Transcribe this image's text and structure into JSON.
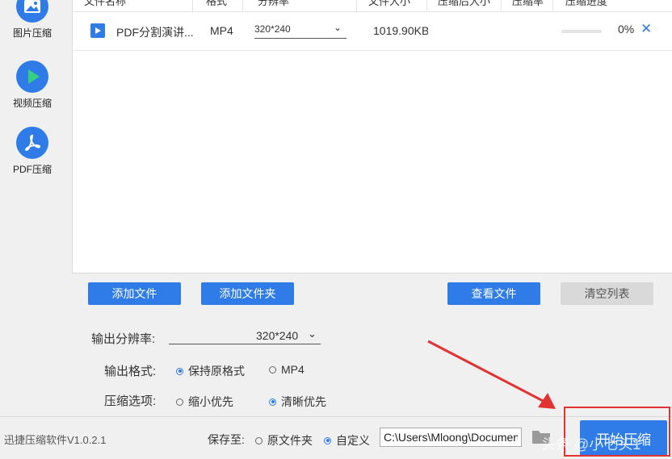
{
  "sidebar": {
    "items": [
      {
        "label": "图片压缩",
        "icon": "image-icon"
      },
      {
        "label": "视频压缩",
        "icon": "play-icon"
      },
      {
        "label": "PDF压缩",
        "icon": "pdf-icon"
      }
    ]
  },
  "table": {
    "headers": [
      "文件名称",
      "格式",
      "分辨率",
      "文件大小",
      "压缩后大小",
      "压缩率",
      "压缩进度"
    ],
    "rows": [
      {
        "name": "PDF分割演讲...",
        "format": "MP4",
        "resolution": "320*240",
        "size": "1019.90KB",
        "compressed_size": "",
        "ratio": "",
        "progress_pct": 0,
        "progress_text": "0%"
      }
    ]
  },
  "buttons": {
    "add_file": "添加文件",
    "add_folder": "添加文件夹",
    "view_files": "查看文件",
    "clear_list": "清空列表"
  },
  "settings": {
    "resolution_label": "输出分辨率:",
    "resolution_value": "320*240",
    "format_label": "输出格式:",
    "format_options": [
      "保持原格式",
      "MP4"
    ],
    "format_selected": "保持原格式",
    "compress_label": "压缩选项:",
    "compress_options": [
      "缩小优先",
      "清晰优先"
    ],
    "compress_selected": "清晰优先"
  },
  "footer": {
    "app_version": "迅捷压缩软件V1.0.2.1",
    "save_to_label": "保存至:",
    "save_options": [
      "原文件夹",
      "自定义"
    ],
    "save_selected": "自定义",
    "path_value": "C:\\Users\\Mloong\\Documents",
    "start_button": "开始压缩",
    "watermark": "头条 @小七头1"
  },
  "colors": {
    "accent": "#2f7ce8",
    "annotation_red": "#e23232",
    "disabled_button": "#d9d9d9"
  }
}
